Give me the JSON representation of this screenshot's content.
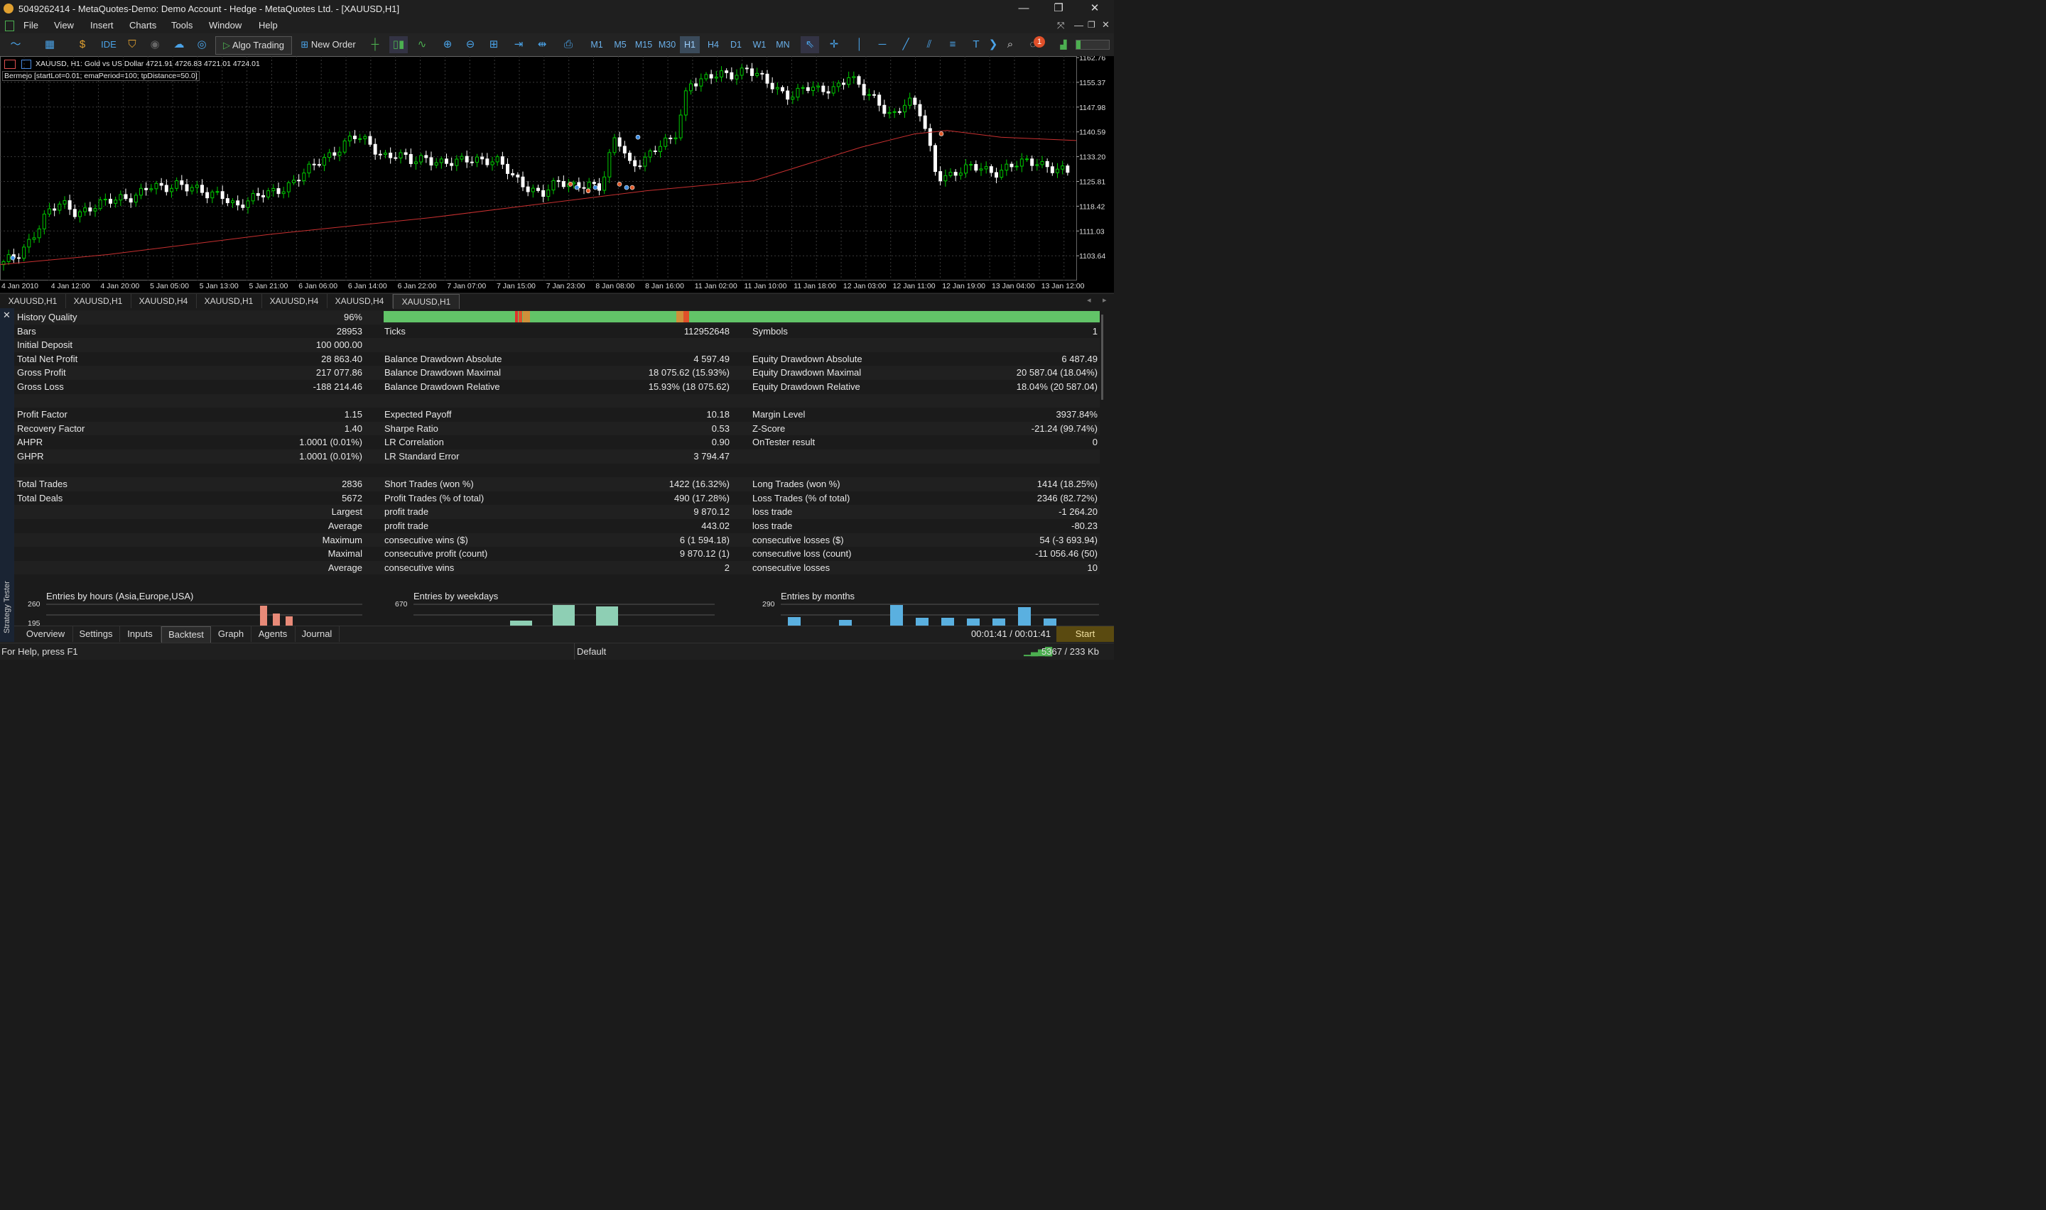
{
  "window": {
    "title": "5049262414 - MetaQuotes-Demo: Demo Account - Hedge - MetaQuotes Ltd. - [XAUUSD,H1]",
    "controls": [
      "—",
      "❐",
      "✕"
    ]
  },
  "menu": [
    "File",
    "View",
    "Insert",
    "Charts",
    "Tools",
    "Window",
    "Help"
  ],
  "toolbar": {
    "ide": "IDE",
    "algo_trading": "Algo Trading",
    "new_order": "New Order",
    "timeframes": [
      "M1",
      "M5",
      "M15",
      "M30",
      "H1",
      "H4",
      "D1",
      "W1",
      "MN"
    ],
    "active_timeframe": "H1",
    "notification_count": "1"
  },
  "chart": {
    "symbol_line": "XAUUSD, H1:  Gold vs US Dollar  4721.91 4726.83 4721.01 4724.01",
    "ea_line": "Bermejo [startLot=0.01; emaPeriod=100; tpDistance=50.0]",
    "price_labels": [
      "1162.76",
      "1155.37",
      "1147.98",
      "1140.59",
      "1133.20",
      "1125.81",
      "1118.42",
      "1111.03",
      "1103.64"
    ],
    "time_labels": [
      "4 Jan 2010",
      "4 Jan 12:00",
      "4 Jan 20:00",
      "5 Jan 05:00",
      "5 Jan 13:00",
      "5 Jan 21:00",
      "6 Jan 06:00",
      "6 Jan 14:00",
      "6 Jan 22:00",
      "7 Jan 07:00",
      "7 Jan 15:00",
      "7 Jan 23:00",
      "8 Jan 08:00",
      "8 Jan 16:00",
      "11 Jan 02:00",
      "11 Jan 10:00",
      "11 Jan 18:00",
      "12 Jan 03:00",
      "12 Jan 11:00",
      "12 Jan 19:00",
      "13 Jan 04:00",
      "13 Jan 12:00"
    ],
    "colors": {
      "bull": "#00c800",
      "bear": "#ffffff",
      "ema": "#c83030",
      "grid": "#3a3a3a"
    }
  },
  "chart_tabs": [
    "XAUUSD,H1",
    "XAUUSD,H1",
    "XAUUSD,H4",
    "XAUUSD,H1",
    "XAUUSD,H4",
    "XAUUSD,H4",
    "XAUUSD,H1"
  ],
  "active_chart_tab": 6,
  "report": {
    "history_quality": {
      "label": "History Quality",
      "value": "96%"
    },
    "col1": [
      {
        "label": "Bars",
        "value": "28953"
      },
      {
        "label": "Initial Deposit",
        "value": "100 000.00"
      },
      {
        "label": "Total Net Profit",
        "value": "28 863.40"
      },
      {
        "label": "Gross Profit",
        "value": "217 077.86"
      },
      {
        "label": "Gross Loss",
        "value": "-188 214.46"
      },
      {
        "label": "",
        "value": ""
      },
      {
        "label": "Profit Factor",
        "value": "1.15"
      },
      {
        "label": "Recovery Factor",
        "value": "1.40"
      },
      {
        "label": "AHPR",
        "value": "1.0001 (0.01%)"
      },
      {
        "label": "GHPR",
        "value": "1.0001 (0.01%)"
      },
      {
        "label": "",
        "value": ""
      },
      {
        "label": "Total Trades",
        "value": "2836"
      },
      {
        "label": "Total Deals",
        "value": "5672"
      },
      {
        "label": "",
        "value": "Largest"
      },
      {
        "label": "",
        "value": "Average"
      },
      {
        "label": "",
        "value": "Maximum"
      },
      {
        "label": "",
        "value": "Maximal"
      },
      {
        "label": "",
        "value": "Average"
      }
    ],
    "col2": [
      {
        "label": "Ticks",
        "value": "112952648"
      },
      {
        "label": "",
        "value": ""
      },
      {
        "label": "Balance Drawdown Absolute",
        "value": "4 597.49"
      },
      {
        "label": "Balance Drawdown Maximal",
        "value": "18 075.62 (15.93%)"
      },
      {
        "label": "Balance Drawdown Relative",
        "value": "15.93% (18 075.62)"
      },
      {
        "label": "",
        "value": ""
      },
      {
        "label": "Expected Payoff",
        "value": "10.18"
      },
      {
        "label": "Sharpe Ratio",
        "value": "0.53"
      },
      {
        "label": "LR Correlation",
        "value": "0.90"
      },
      {
        "label": "LR Standard Error",
        "value": "3 794.47"
      },
      {
        "label": "",
        "value": ""
      },
      {
        "label": "Short Trades (won %)",
        "value": "1422 (16.32%)"
      },
      {
        "label": "Profit Trades (% of total)",
        "value": "490 (17.28%)"
      },
      {
        "label": "profit trade",
        "value": "9 870.12"
      },
      {
        "label": "profit trade",
        "value": "443.02"
      },
      {
        "label": "consecutive wins ($)",
        "value": "6 (1 594.18)"
      },
      {
        "label": "consecutive profit (count)",
        "value": "9 870.12 (1)"
      },
      {
        "label": "consecutive wins",
        "value": "2"
      }
    ],
    "col3": [
      {
        "label": "Symbols",
        "value": "1"
      },
      {
        "label": "",
        "value": ""
      },
      {
        "label": "Equity Drawdown Absolute",
        "value": "6 487.49"
      },
      {
        "label": "Equity Drawdown Maximal",
        "value": "20 587.04 (18.04%)"
      },
      {
        "label": "Equity Drawdown Relative",
        "value": "18.04% (20 587.04)"
      },
      {
        "label": "",
        "value": ""
      },
      {
        "label": "Margin Level",
        "value": "3937.84%"
      },
      {
        "label": "Z-Score",
        "value": "-21.24 (99.74%)"
      },
      {
        "label": "OnTester result",
        "value": "0"
      },
      {
        "label": "",
        "value": ""
      },
      {
        "label": "",
        "value": ""
      },
      {
        "label": "Long Trades (won %)",
        "value": "1414 (18.25%)"
      },
      {
        "label": "Loss Trades (% of total)",
        "value": "2346 (82.72%)"
      },
      {
        "label": "loss trade",
        "value": "-1 264.20"
      },
      {
        "label": "loss trade",
        "value": "-80.23"
      },
      {
        "label": "consecutive losses ($)",
        "value": "54 (-3 693.94)"
      },
      {
        "label": "consecutive loss (count)",
        "value": "-11 056.46 (50)"
      },
      {
        "label": "consecutive losses",
        "value": "10"
      }
    ]
  },
  "mini_charts": [
    {
      "title": "Entries by hours (Asia,Europe,USA)",
      "ytop": "260",
      "ymid": "195"
    },
    {
      "title": "Entries by weekdays",
      "ytop": "670"
    },
    {
      "title": "Entries by months",
      "ytop": "290"
    }
  ],
  "sidebar_label": "Strategy Tester",
  "bottom_tabs": [
    "Overview",
    "Settings",
    "Inputs",
    "Backtest",
    "Graph",
    "Agents",
    "Journal"
  ],
  "active_bottom_tab": "Backtest",
  "timer": "00:01:41 / 00:01:41",
  "start_button": "Start",
  "status": {
    "help": "For Help, press F1",
    "profile": "Default",
    "connection": "5367 / 233 Kb"
  }
}
